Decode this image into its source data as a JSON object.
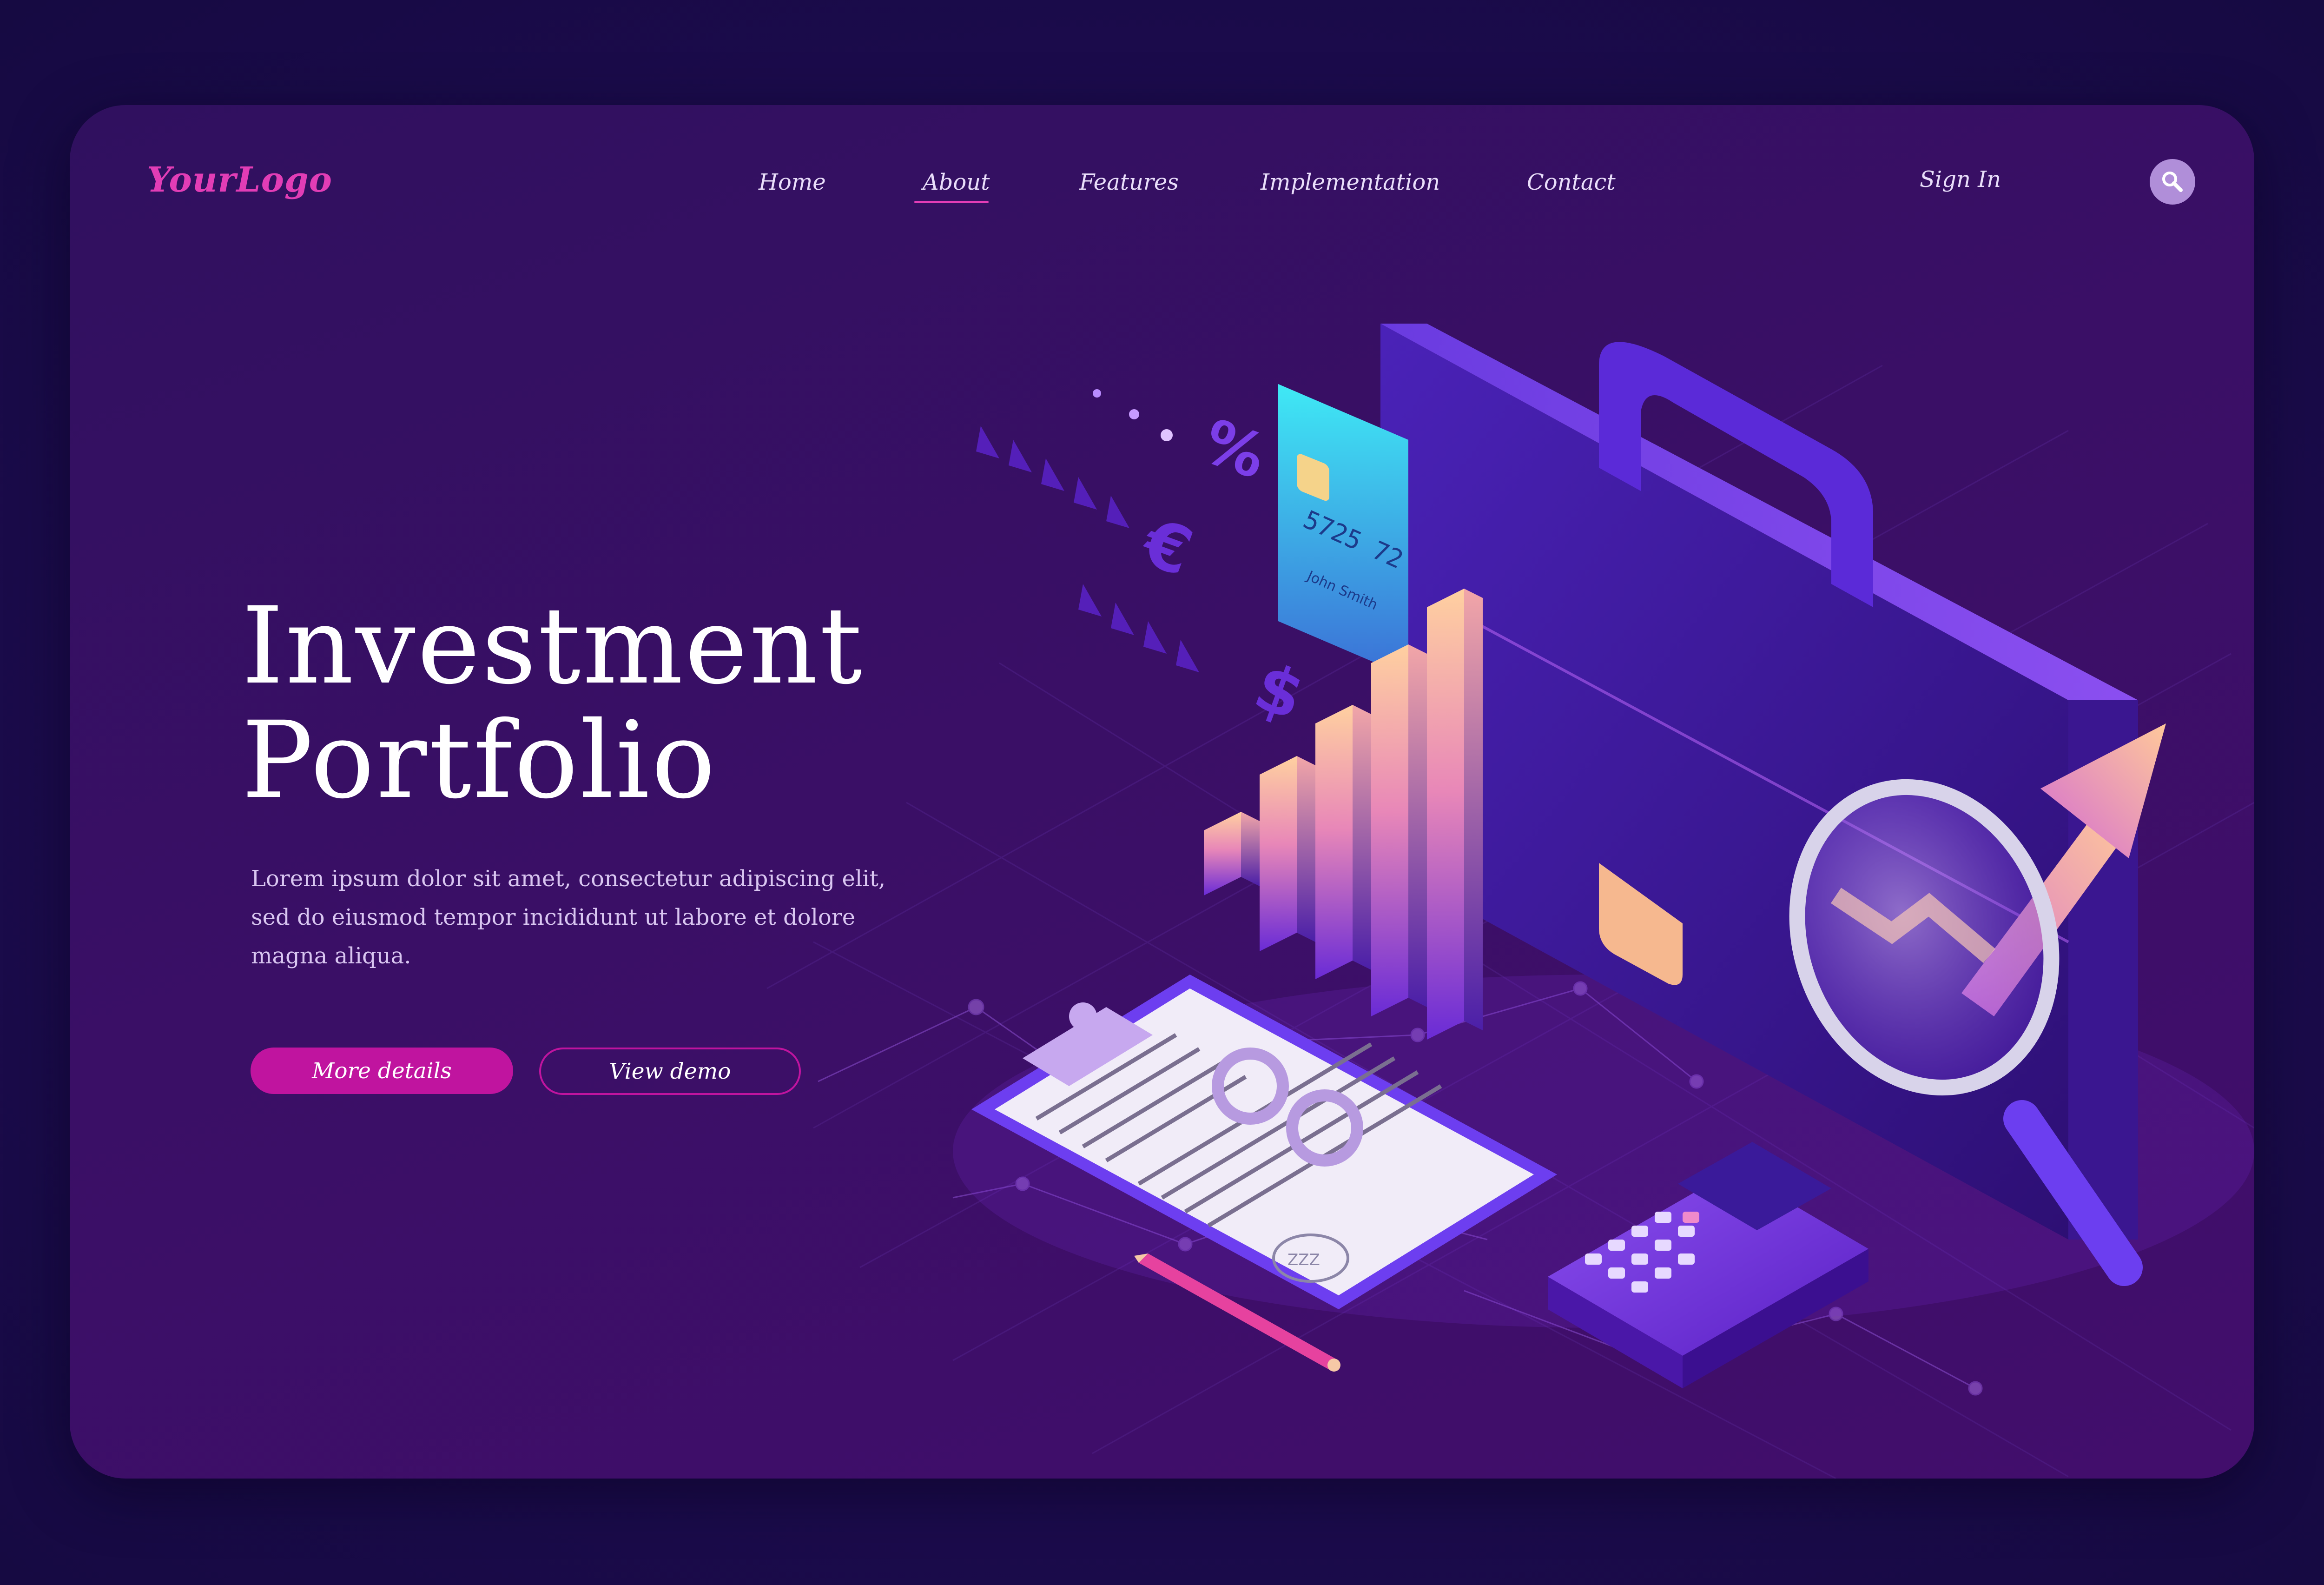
{
  "header": {
    "logo": "YourLogo",
    "nav": [
      {
        "label": "Home"
      },
      {
        "label": "About",
        "active": true
      },
      {
        "label": "Features"
      },
      {
        "label": "Implementation"
      },
      {
        "label": "Contact"
      }
    ],
    "sign_in": "Sign In",
    "search_icon": "search-icon"
  },
  "hero": {
    "title_line1": "Investment",
    "title_line2": "Portfolio",
    "description": "Lorem ipsum dolor sit amet, consectetur adipiscing elit, sed do eiusmod tempor incididunt ut labore et dolore magna aliqua.",
    "primary_button": "More details",
    "secondary_button": "View demo"
  },
  "illustration": {
    "card_number": "5725 72",
    "card_holder": "John Smith",
    "symbols": [
      "%",
      "€",
      "$"
    ],
    "stamp_text": "ZZZ"
  },
  "colors": {
    "accent": "#c0149f",
    "logo": "#e23db6",
    "background": "#1c0b4d",
    "card": "#3a0f66"
  }
}
